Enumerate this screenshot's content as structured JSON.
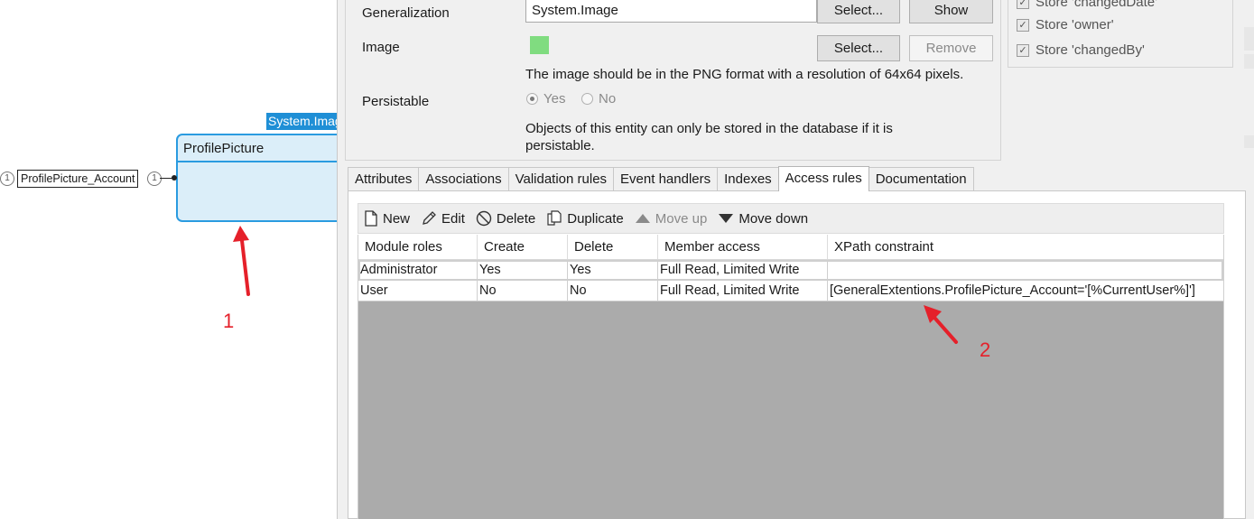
{
  "canvas": {
    "entity": {
      "name": "ProfilePicture",
      "generalization_tag": "System.Image"
    },
    "association": {
      "label": "ProfilePicture_Account",
      "left_multiplicity": "1",
      "right_multiplicity": "1"
    },
    "annotations": [
      {
        "number": "1"
      },
      {
        "number": "2"
      }
    ]
  },
  "dialog": {
    "generalization": {
      "label": "Generalization",
      "value": "System.Image",
      "select_label": "Select...",
      "show_label": "Show"
    },
    "image": {
      "label": "Image",
      "select_label": "Select...",
      "remove_label": "Remove",
      "hint": "The image should be in the PNG format with a resolution of 64x64 pixels.",
      "swatch_color": "#80dc80"
    },
    "persistable": {
      "label": "Persistable",
      "yes_label": "Yes",
      "no_label": "No",
      "selected": "Yes",
      "hint_line1": "Objects of this entity can only be stored in the database if it is",
      "hint_line2": "persistable."
    },
    "store_options": [
      {
        "label": "Store 'changedDate'",
        "checked": true
      },
      {
        "label": "Store 'owner'",
        "checked": true
      },
      {
        "label": "Store 'changedBy'",
        "checked": true
      }
    ],
    "tabs": [
      {
        "label": "Attributes"
      },
      {
        "label": "Associations"
      },
      {
        "label": "Validation rules"
      },
      {
        "label": "Event handlers"
      },
      {
        "label": "Indexes"
      },
      {
        "label": "Access rules",
        "active": true
      },
      {
        "label": "Documentation"
      }
    ],
    "toolbar": {
      "new_label": "New",
      "edit_label": "Edit",
      "delete_label": "Delete",
      "duplicate_label": "Duplicate",
      "move_up_label": "Move up",
      "move_down_label": "Move down"
    },
    "access_rules": {
      "columns": [
        "Module roles",
        "Create",
        "Delete",
        "Member access",
        "XPath constraint"
      ],
      "rows": [
        {
          "role": "Administrator",
          "create": "Yes",
          "delete": "Yes",
          "member_access": "Full Read, Limited Write",
          "xpath": ""
        },
        {
          "role": "User",
          "create": "No",
          "delete": "No",
          "member_access": "Full Read, Limited Write",
          "xpath": "[GeneralExtentions.ProfilePicture_Account='[%CurrentUser%]']"
        }
      ]
    }
  },
  "colors": {
    "accent": "#2a9be0",
    "entity_fill": "#dbeef9",
    "annotation": "#e5202a",
    "grid_empty": "#ababab"
  }
}
